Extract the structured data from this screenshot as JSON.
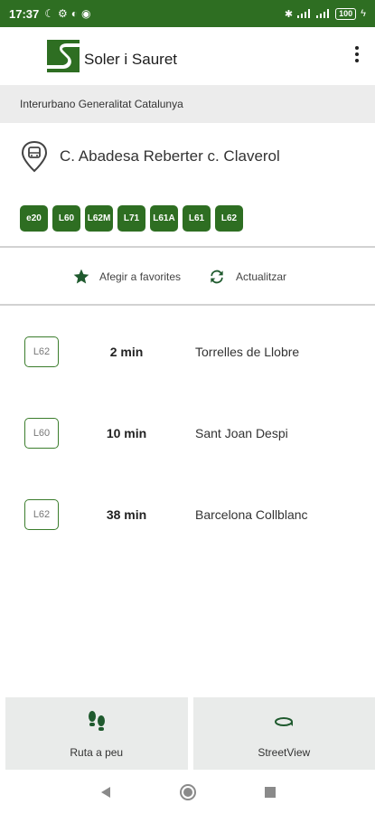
{
  "status_bar": {
    "time": "17:37",
    "battery": "100"
  },
  "header": {
    "brand": "Soler i Sauret"
  },
  "category": "Interurbano Generalitat Catalunya",
  "stop": {
    "name": "C. Abadesa Reberter  c. Claverol"
  },
  "lines": [
    "e20",
    "L60",
    "L62M",
    "L71",
    "L61A",
    "L61",
    "L62"
  ],
  "actions": {
    "favorite": "Afegir a favorites",
    "refresh": "Actualitzar"
  },
  "arrivals": [
    {
      "line": "L62",
      "eta": "2 min",
      "destination": "Torrelles de Llobre"
    },
    {
      "line": "L60",
      "eta": "10 min",
      "destination": "Sant Joan Despi"
    },
    {
      "line": "L62",
      "eta": "38 min",
      "destination": "Barcelona Collblanc"
    }
  ],
  "bottom": {
    "walk_route": "Ruta a peu",
    "street_view": "StreetView"
  },
  "colors": {
    "brand_green": "#2e6e22",
    "band_gray": "#ececec"
  },
  "icons": [
    "moon-icon",
    "wifi-icon",
    "bluetooth-icon",
    "signal-icon",
    "battery-icon",
    "bus-stop-icon",
    "star-icon",
    "refresh-icon",
    "footsteps-icon",
    "street-view-icon",
    "back-icon",
    "home-icon",
    "recents-icon"
  ]
}
